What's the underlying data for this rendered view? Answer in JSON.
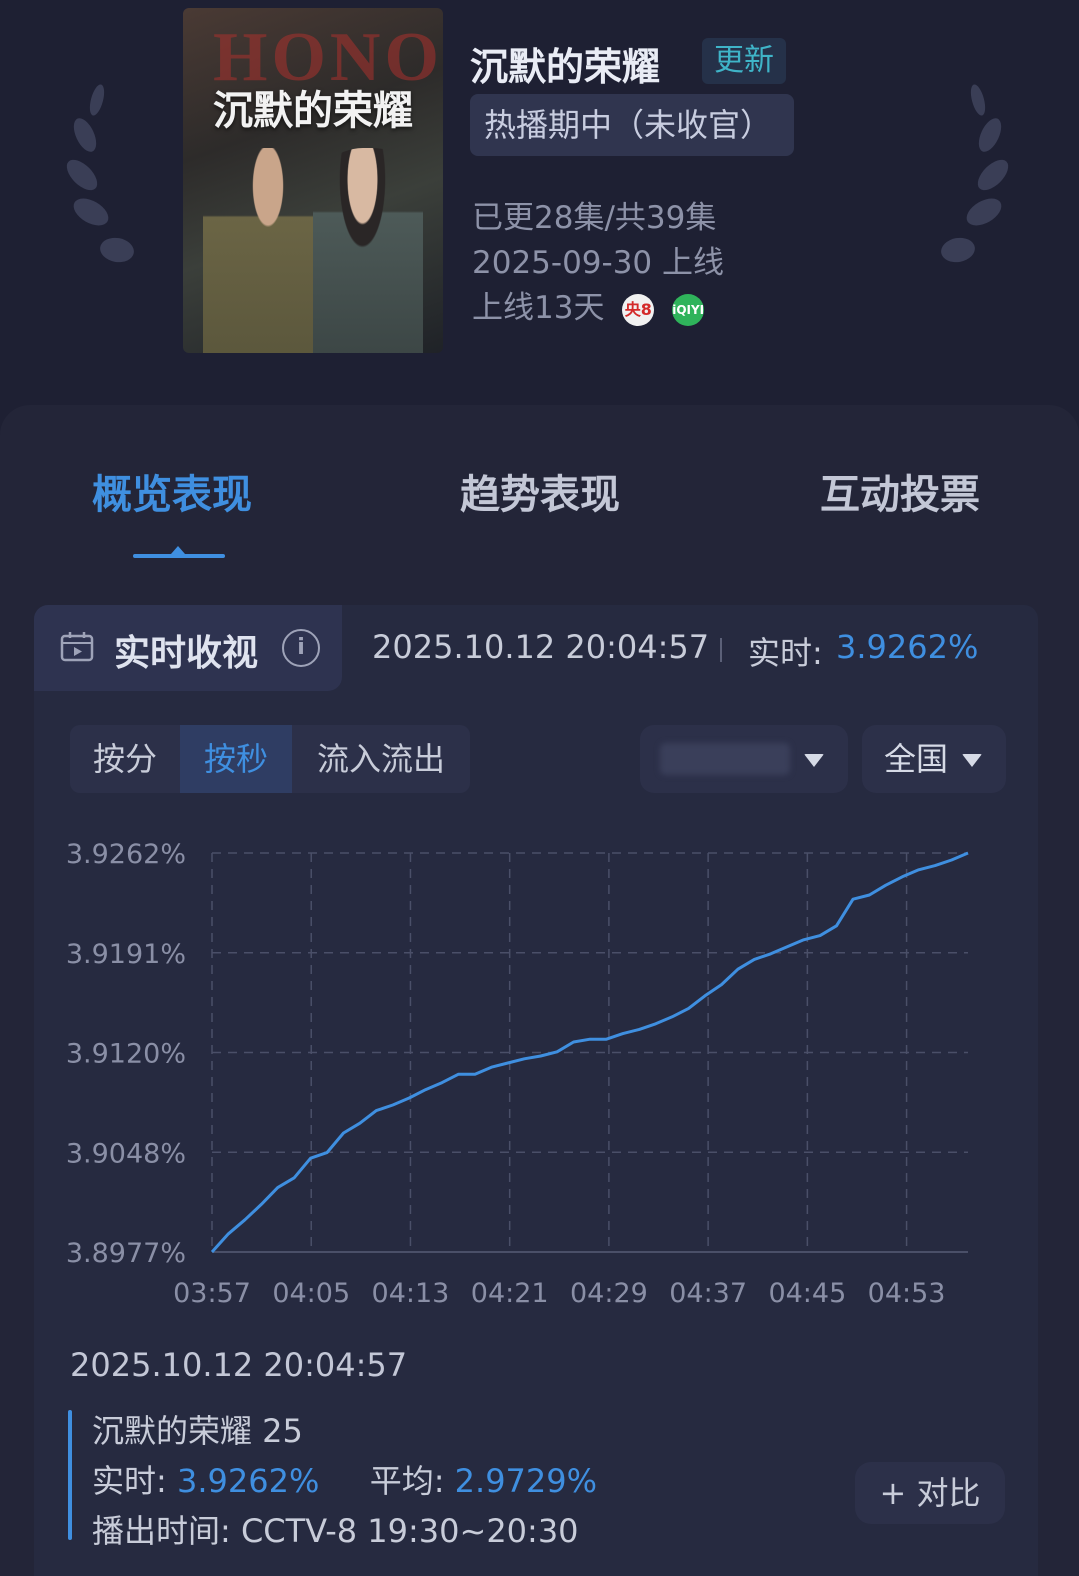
{
  "show": {
    "title": "沉默的荣耀",
    "update_badge": "更新",
    "status": "热播期中（未收官）",
    "episodes": "已更28集/共39集",
    "release": "2025-09-30 上线",
    "days_online": "上线13天",
    "channels": [
      "cctv8-icon",
      "iqiyi-icon"
    ],
    "channel_icon_text": {
      "cctv": "央8",
      "iqiyi": "iQIYI"
    }
  },
  "poster": {
    "title": "沉默的荣耀",
    "background_text": "HONOR"
  },
  "tabs": [
    {
      "label": "概览表现",
      "active": true
    },
    {
      "label": "趋势表现",
      "active": false
    },
    {
      "label": "互动投票",
      "active": false
    }
  ],
  "realtime": {
    "label": "实时收视",
    "timestamp": "2025.10.12 20:04:57",
    "now_label": "实时:",
    "now_value": "3.9262%"
  },
  "granularity": [
    {
      "label": "按分",
      "active": false
    },
    {
      "label": "按秒",
      "active": true
    },
    {
      "label": "流入流出",
      "active": false
    }
  ],
  "region_dropdown": "全国",
  "chart_data": {
    "type": "line",
    "x_ticks": [
      "03:57",
      "04:05",
      "04:13",
      "04:21",
      "04:29",
      "04:37",
      "04:45",
      "04:53"
    ],
    "y_ticks": [
      "3.9262%",
      "3.9191%",
      "3.9120%",
      "3.9048%",
      "3.8977%"
    ],
    "ylim": [
      3.8977,
      3.9262
    ],
    "grid": true,
    "series": [
      {
        "values_note": "minutes from 03:57 vs rating %",
        "points": [
          [
            0,
            3.8977
          ],
          [
            1,
            3.899
          ],
          [
            2,
            3.9
          ],
          [
            3,
            3.9011
          ],
          [
            4,
            3.9023
          ],
          [
            5,
            3.903
          ],
          [
            6,
            3.9044
          ],
          [
            7,
            3.9048
          ],
          [
            8,
            3.9062
          ],
          [
            9,
            3.9069
          ],
          [
            10,
            3.9078
          ],
          [
            11,
            3.9082
          ],
          [
            12,
            3.9087
          ],
          [
            13,
            3.9093
          ],
          [
            14,
            3.9098
          ],
          [
            15,
            3.9104
          ],
          [
            16,
            3.9104
          ],
          [
            17,
            3.9109
          ],
          [
            18,
            3.9112
          ],
          [
            19,
            3.9115
          ],
          [
            20,
            3.9117
          ],
          [
            21,
            3.912
          ],
          [
            22,
            3.9127
          ],
          [
            23,
            3.9129
          ],
          [
            24,
            3.9129
          ],
          [
            25,
            3.9133
          ],
          [
            26,
            3.9136
          ],
          [
            27,
            3.914
          ],
          [
            28,
            3.9145
          ],
          [
            29,
            3.9151
          ],
          [
            30,
            3.916
          ],
          [
            31,
            3.9168
          ],
          [
            32,
            3.9179
          ],
          [
            33,
            3.9186
          ],
          [
            34,
            3.919
          ],
          [
            35,
            3.9195
          ],
          [
            36,
            3.92
          ],
          [
            37,
            3.9203
          ],
          [
            38,
            3.921
          ],
          [
            39,
            3.9229
          ],
          [
            40,
            3.9232
          ],
          [
            41,
            3.9239
          ],
          [
            42,
            3.9245
          ],
          [
            43,
            3.925
          ],
          [
            44,
            3.9253
          ],
          [
            45,
            3.9257
          ],
          [
            46,
            3.9262
          ]
        ]
      }
    ]
  },
  "footer": {
    "timestamp": "2025.10.12 20:04:57",
    "episode": "沉默的荣耀 25",
    "realtime_label": "实时:",
    "realtime_value": "3.9262%",
    "average_label": "平均:",
    "average_value": "2.9729%",
    "airtime": "播出时间:  CCTV-8 19:30~20:30",
    "compare_button": "+ 对比"
  },
  "colors": {
    "accent": "#3f8fe0",
    "background": "#1e2033",
    "line": "#3f8fe0",
    "update_badge": "#3fb4c8"
  }
}
